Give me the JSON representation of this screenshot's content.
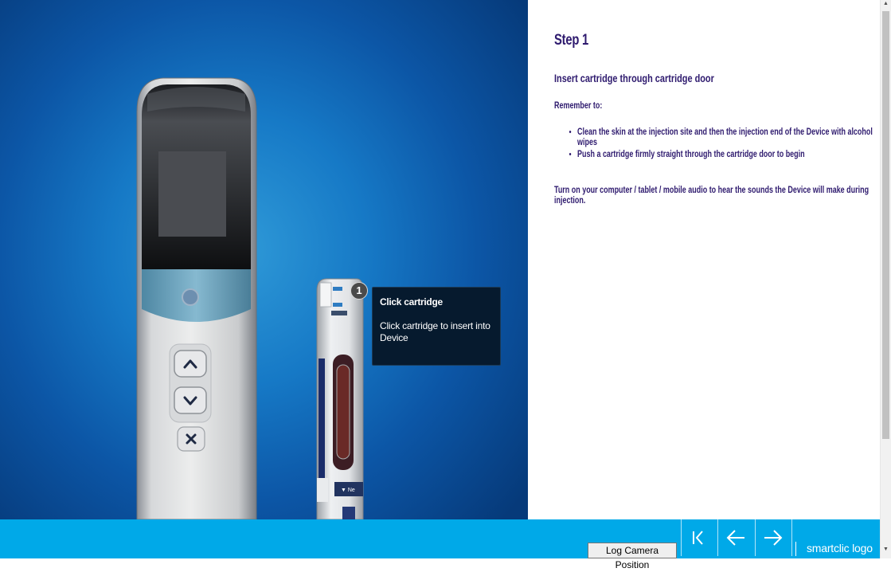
{
  "instructions": {
    "step_title": "Step 1",
    "subheading": "Insert cartridge through cartridge door",
    "remember_label": "Remember to:",
    "bullets": [
      "Clean the skin at the injection site and then the injection end of the Device with alcohol wipes",
      "Push a cartridge firmly straight through the cartridge door to begin"
    ],
    "note": "Turn on your computer / tablet / mobile audio to hear the sounds the Device will make during injection."
  },
  "tooltip": {
    "badge_number": "1",
    "title": "Click cartridge",
    "body": "Click cartridge to insert into Device"
  },
  "device": {
    "button_up_icon": "chevron-up-icon",
    "button_down_icon": "chevron-down-icon",
    "button_close_icon": "close-icon"
  },
  "footer": {
    "log_button": "Log Camera Position",
    "nav_first_icon": "skip-to-first-icon",
    "nav_prev_icon": "arrow-left-icon",
    "nav_next_icon": "arrow-right-icon",
    "logo_text": "smartclic logo"
  },
  "colors": {
    "footer_bg": "#00a9e8",
    "text_purple": "#2e1a6e",
    "tooltip_bg": "#061a2e",
    "viewport_blue": "#1679c6"
  }
}
